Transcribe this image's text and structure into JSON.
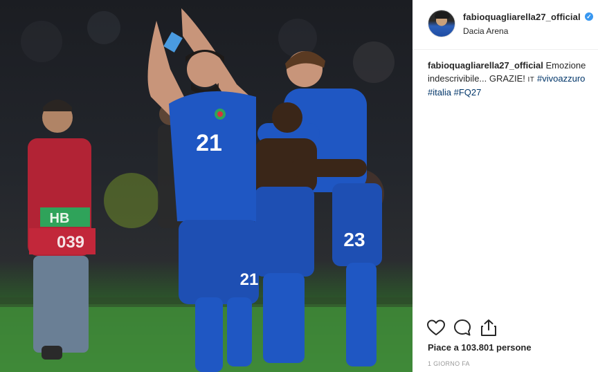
{
  "post": {
    "username": "fabioquagliarella27_official",
    "verified": true,
    "location": "Dacia Arena",
    "caption": {
      "username": "fabioquagliarella27_official",
      "text": " Emozione indescrivibile... GRAZIE! ",
      "flag": "IT",
      "hashtag_1": "#vivoazzuro",
      "hashtag_2": "#italia",
      "hashtag_3": "#FQ27"
    },
    "likes_text": "Piace a 103.801 persone",
    "timestamp": "1 GIORNO FA"
  },
  "photo": {
    "player_main_number": "21",
    "player_main_shorts_number": "21",
    "player_right_number": "23",
    "player_right_shorts_number": "23",
    "steward_bib_label": "HB",
    "steward_bib_number": "039"
  },
  "icons": {
    "like": "heart-icon",
    "comment": "comment-icon",
    "share": "share-icon",
    "verified": "verified-badge-icon"
  },
  "colors": {
    "italy_blue": "#1f57c3",
    "verified_blue": "#3897f0",
    "hashtag_blue": "#003569",
    "steward_red": "#c2273a",
    "pitch_green": "#3f8a38"
  }
}
